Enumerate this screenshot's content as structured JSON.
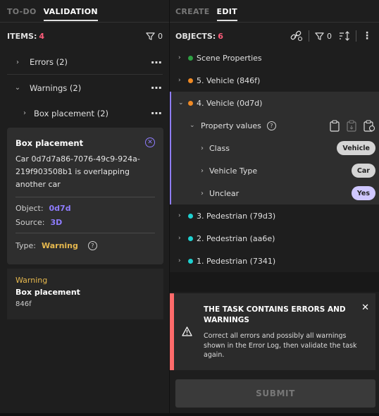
{
  "left": {
    "tabs": [
      {
        "label": "TO-DO",
        "active": false
      },
      {
        "label": "VALIDATION",
        "active": true
      }
    ],
    "items_label": "ITEMS:",
    "items_count": "4",
    "filter_count": "0",
    "groups": {
      "errors": "Errors (2)",
      "warnings": "Warnings (2)",
      "box_placement": "Box placement (2)"
    },
    "detail": {
      "title": "Box placement",
      "message": "Car 0d7d7a86-7076-49c9-924a-219f903508b1 is overlapping another car",
      "object_label": "Object:",
      "object_value": "0d7d",
      "source_label": "Source:",
      "source_value": "3D",
      "type_label": "Type:",
      "type_value": "Warning"
    },
    "item": {
      "level": "Warning",
      "title": "Box placement",
      "id": "846f"
    }
  },
  "right": {
    "tabs": [
      {
        "label": "CREATE",
        "active": false
      },
      {
        "label": "EDIT",
        "active": true
      }
    ],
    "objects_label": "OBJECTS:",
    "objects_count": "6",
    "filter_count": "0",
    "objects": {
      "scene": {
        "label": "Scene Properties",
        "color": "#2ea043"
      },
      "vehicle5": {
        "label": "5. Vehicle (846f)",
        "color": "#f08a24"
      },
      "vehicle4": {
        "label": "4. Vehicle (0d7d)",
        "color": "#f08a24"
      },
      "ped3": {
        "label": "3. Pedestrian (79d3)",
        "color": "#1fd1d1"
      },
      "ped2": {
        "label": "2. Pedestrian (aa6e)",
        "color": "#1fd1d1"
      },
      "ped1": {
        "label": "1. Pedestrian (7341)",
        "color": "#1fd1d1"
      }
    },
    "property_values": "Property values",
    "properties": [
      {
        "name": "Class",
        "value": "Vehicle"
      },
      {
        "name": "Vehicle Type",
        "value": "Car"
      },
      {
        "name": "Unclear",
        "value": "Yes"
      }
    ],
    "alert": {
      "title": "THE TASK CONTAINS ERRORS AND WARNINGS",
      "body": "Correct all errors and possibly all warnings shown in the Error Log, then validate the task again."
    },
    "submit_label": "SUBMIT"
  }
}
